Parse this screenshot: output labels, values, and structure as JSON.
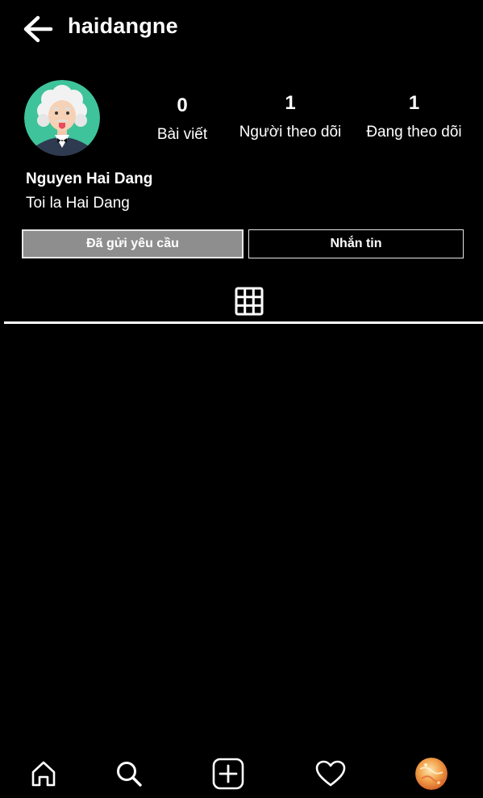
{
  "header": {
    "username": "haidangne",
    "back_icon": "arrow-left-icon"
  },
  "profile": {
    "avatar_icon": "cartoon-avatar-icon",
    "stats": [
      {
        "value": "0",
        "label": "Bài viết"
      },
      {
        "value": "1",
        "label": "Người theo dõi"
      },
      {
        "value": "1",
        "label": "Đang theo dõi"
      }
    ],
    "full_name": "Nguyen Hai Dang",
    "bio": "Toi la Hai Dang"
  },
  "actions": {
    "requested_label": "Đã gửi yêu cầu",
    "message_label": "Nhắn tin"
  },
  "tabs": {
    "grid_icon": "grid-icon"
  },
  "bottom_nav": [
    {
      "icon": "home-icon"
    },
    {
      "icon": "search-icon"
    },
    {
      "icon": "add-post-icon"
    },
    {
      "icon": "heart-icon"
    },
    {
      "icon": "profile-avatar-icon"
    }
  ],
  "colors": {
    "background": "#000000",
    "text": "#ffffff",
    "requested_button_bg": "#8e8e8e",
    "button_border": "#e6e6e6",
    "avatar_bg": "#3fc39a"
  }
}
